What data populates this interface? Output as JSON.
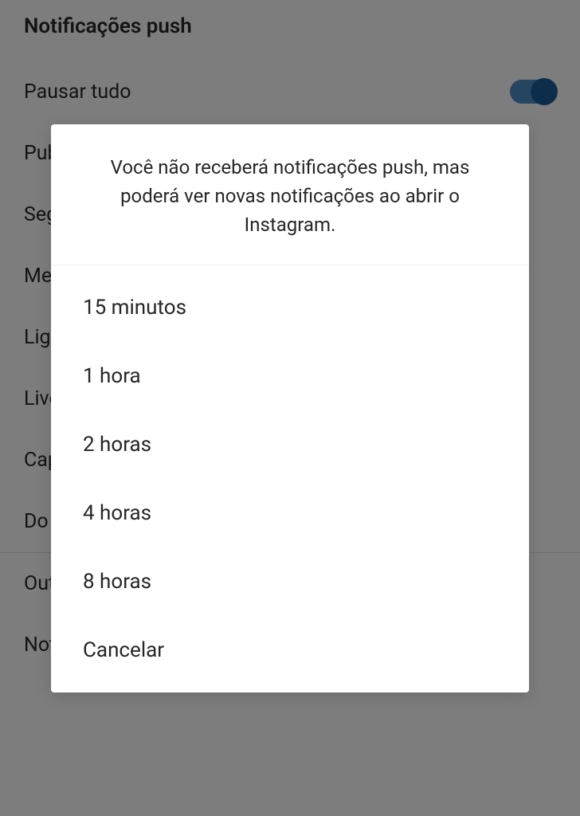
{
  "page": {
    "title": "Notificações push"
  },
  "settings": {
    "pauseAll": {
      "label": "Pausar tudo"
    },
    "items": [
      "Publicações, stories e comentários",
      "Seguidores e seguindo",
      "Mensagens",
      "Ligações",
      "Live e Reels",
      "Captação de recursos",
      "Do Instagram"
    ],
    "otherSection": "Outros tipos de notificação",
    "email": "Notificações por email"
  },
  "modal": {
    "message": "Você não receberá notificações push, mas poderá ver novas notificações ao abrir o Instagram.",
    "options": [
      "15 minutos",
      "1 hora",
      "2 horas",
      "4 horas",
      "8 horas"
    ],
    "cancel": "Cancelar"
  }
}
